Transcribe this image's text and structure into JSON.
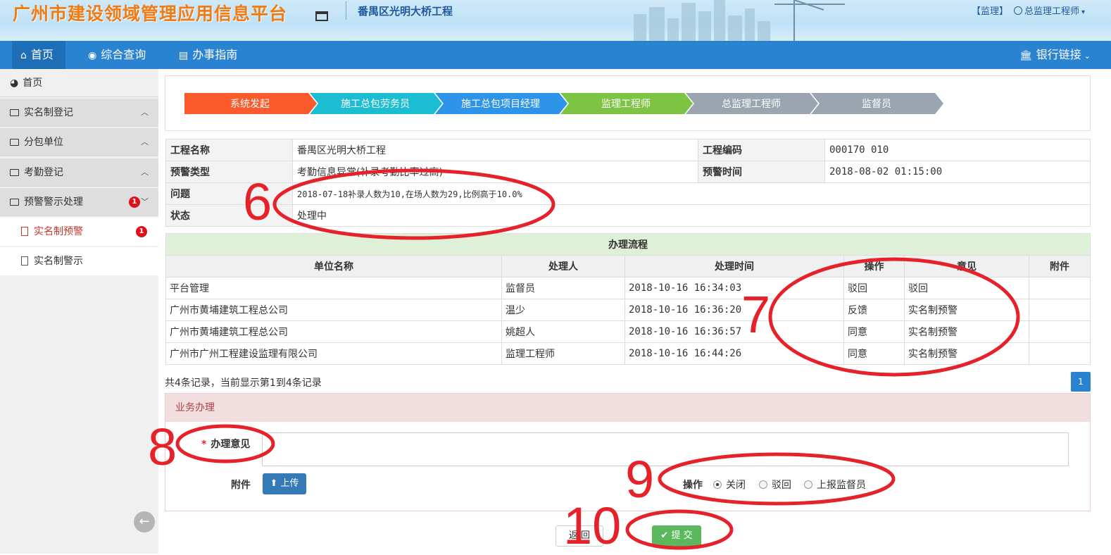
{
  "header": {
    "title": "广州市建设领域管理应用信息平台",
    "project": "番禺区光明大桥工程",
    "role": "【监理】",
    "user": "总监理工程师"
  },
  "nav": {
    "items": [
      "首页",
      "综合查询",
      "办事指南"
    ],
    "right": "银行链接"
  },
  "sidebar": {
    "home": "首页",
    "groups": [
      "实名制登记",
      "分包单位",
      "考勤登记",
      "预警警示处理"
    ],
    "subitems": [
      "实名制预警",
      "实名制警示"
    ],
    "badge_group": "1",
    "badge_sub": "1"
  },
  "steps": [
    "系统发起",
    "施工总包劳务员",
    "施工总包项目经理",
    "监理工程师",
    "总监理工程师",
    "监督员"
  ],
  "step_colors": [
    "#fa5a2c",
    "#1bbdd2",
    "#2d94e9",
    "#7ec443",
    "#9aa5b0",
    "#9aa5b0"
  ],
  "info": {
    "project_name_label": "工程名称",
    "project_name": "番禺区光明大桥工程",
    "project_code_label": "工程编码",
    "project_code": "000170    010",
    "warn_type_label": "预警类型",
    "warn_type": "考勤信息异常(补录考勤比率过高)",
    "warn_time_label": "预警时间",
    "warn_time": "2018-08-02 01:15:00",
    "issue_label": "问题",
    "issue": "2018-07-18补录人数为10,在场人数为29,比例高于10.0%",
    "status_label": "状态",
    "status": "处理中"
  },
  "process": {
    "caption": "办理流程",
    "headers": [
      "单位名称",
      "处理人",
      "处理时间",
      "操作",
      "意见",
      "附件"
    ],
    "rows": [
      [
        "平台管理",
        "监督员",
        "2018-10-16 16:34:03",
        "驳回",
        "驳回",
        ""
      ],
      [
        "广州市黄埔建筑工程总公司",
        "温少",
        "2018-10-16 16:36:20",
        "反馈",
        "实名制预警",
        ""
      ],
      [
        "广州市黄埔建筑工程总公司",
        "姚超人",
        "2018-10-16 16:36:57",
        "同意",
        "实名制预警",
        ""
      ],
      [
        "广州市广州工程建设监理有限公司",
        "监理工程师",
        "2018-10-16 16:44:26",
        "同意",
        "实名制预警",
        ""
      ]
    ],
    "records": "共4条记录，当前显示第1到4条记录",
    "page": "1"
  },
  "business": {
    "title": "业务办理",
    "opinion_label": "办理意见",
    "required": "*",
    "attach_label": "附件",
    "upload": "上传",
    "op_label": "操作",
    "options": [
      "关闭",
      "驳回",
      "上报监督员"
    ],
    "back": "返 回",
    "submit": "提 交"
  },
  "annotations": [
    "6",
    "7",
    "8",
    "9",
    "10"
  ]
}
